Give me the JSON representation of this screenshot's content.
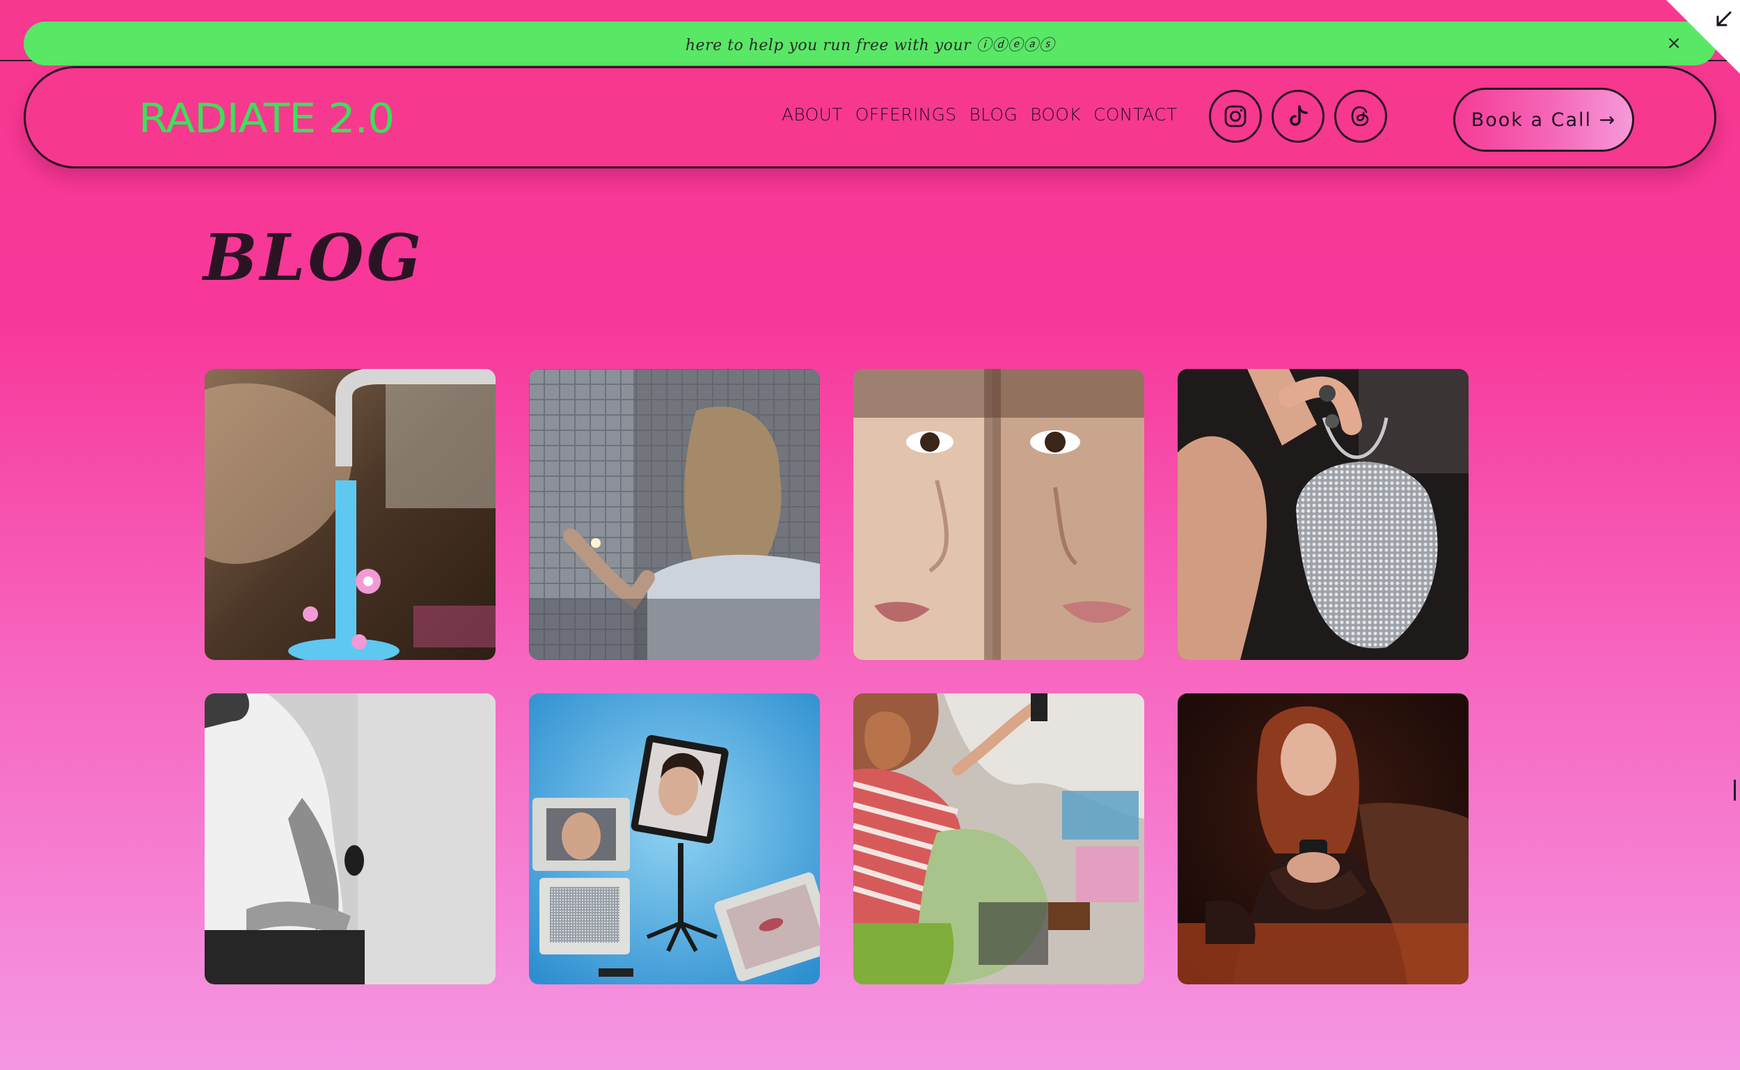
{
  "announcement": {
    "text": "here to help you run free with your ⓘⓓⓔⓐⓢ",
    "close_label": "×"
  },
  "header": {
    "logo": "RADIATE 2.0",
    "nav": [
      {
        "label": "ABOUT"
      },
      {
        "label": "OFFERINGS"
      },
      {
        "label": "BLOG"
      },
      {
        "label": "BOOK"
      },
      {
        "label": "CONTACT"
      }
    ],
    "social_icons": [
      "instagram-icon",
      "tiktok-icon",
      "threads-icon"
    ],
    "cta_label": "Book a Call →"
  },
  "page": {
    "title": "BLOG"
  },
  "blog_posts": [
    {
      "thumbnail": "woman-under-faucet-with-flowers"
    },
    {
      "thumbnail": "woman-holding-light-in-tiled-bathroom"
    },
    {
      "thumbnail": "two-faces-closeup"
    },
    {
      "thumbnail": "hand-with-silver-bag"
    },
    {
      "thumbnail": "bw-person-holding-arm"
    },
    {
      "thumbnail": "tv-screens-and-mirror-blue-room"
    },
    {
      "thumbnail": "person-lying-on-clothes-pile"
    },
    {
      "thumbnail": "woman-looking-at-phone"
    }
  ],
  "colors": {
    "background_top": "#f7388f",
    "background_bottom": "#f597e4",
    "announcement_bg": "#59e766",
    "logo": "#3de05a",
    "ink": "#2a1424"
  }
}
